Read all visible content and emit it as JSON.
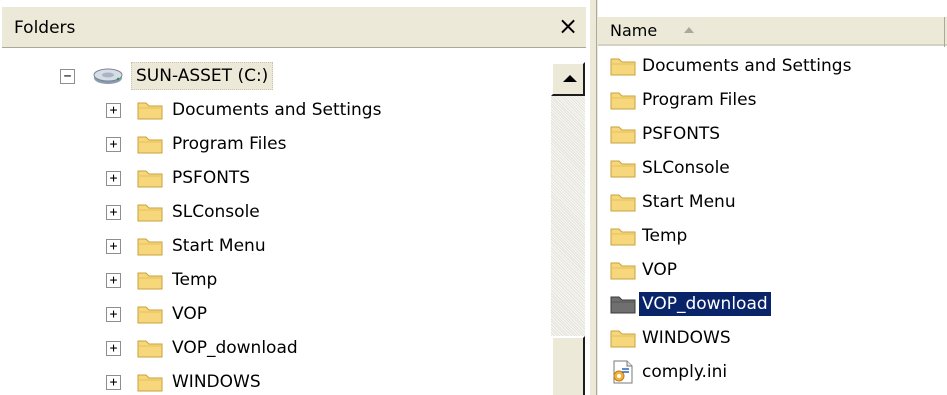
{
  "folders_pane": {
    "title": "Folders",
    "close_glyph": "×",
    "root": {
      "label": "SUN-ASSET (C:)",
      "expander": "−",
      "icon": "drive-icon"
    },
    "children": [
      {
        "label": "Documents and Settings",
        "expander": "+"
      },
      {
        "label": "Program Files",
        "expander": "+"
      },
      {
        "label": "PSFONTS",
        "expander": "+"
      },
      {
        "label": "SLConsole",
        "expander": "+"
      },
      {
        "label": "Start Menu",
        "expander": "+"
      },
      {
        "label": "Temp",
        "expander": "+"
      },
      {
        "label": "VOP",
        "expander": "+"
      },
      {
        "label": "VOP_download",
        "expander": "+"
      },
      {
        "label": "WINDOWS",
        "expander": "+"
      }
    ]
  },
  "contents_pane": {
    "column_header": {
      "name": "Name",
      "sort": "ascending"
    },
    "items": [
      {
        "label": "Documents and Settings",
        "type": "folder",
        "selected": false
      },
      {
        "label": "Program Files",
        "type": "folder",
        "selected": false
      },
      {
        "label": "PSFONTS",
        "type": "folder",
        "selected": false
      },
      {
        "label": "SLConsole",
        "type": "folder",
        "selected": false
      },
      {
        "label": "Start Menu",
        "type": "folder",
        "selected": false
      },
      {
        "label": "Temp",
        "type": "folder",
        "selected": false
      },
      {
        "label": "VOP",
        "type": "folder",
        "selected": false
      },
      {
        "label": "VOP_download",
        "type": "folder",
        "selected": true
      },
      {
        "label": "WINDOWS",
        "type": "folder",
        "selected": false
      },
      {
        "label": "comply.ini",
        "type": "ini-file",
        "selected": false
      }
    ]
  },
  "colors": {
    "chrome": "#ece9d8",
    "folder_fill": "#f6d77c",
    "folder_edge": "#c9a23c",
    "selection": "#0a246a",
    "selected_folder_fill": "#6f6f6f"
  }
}
